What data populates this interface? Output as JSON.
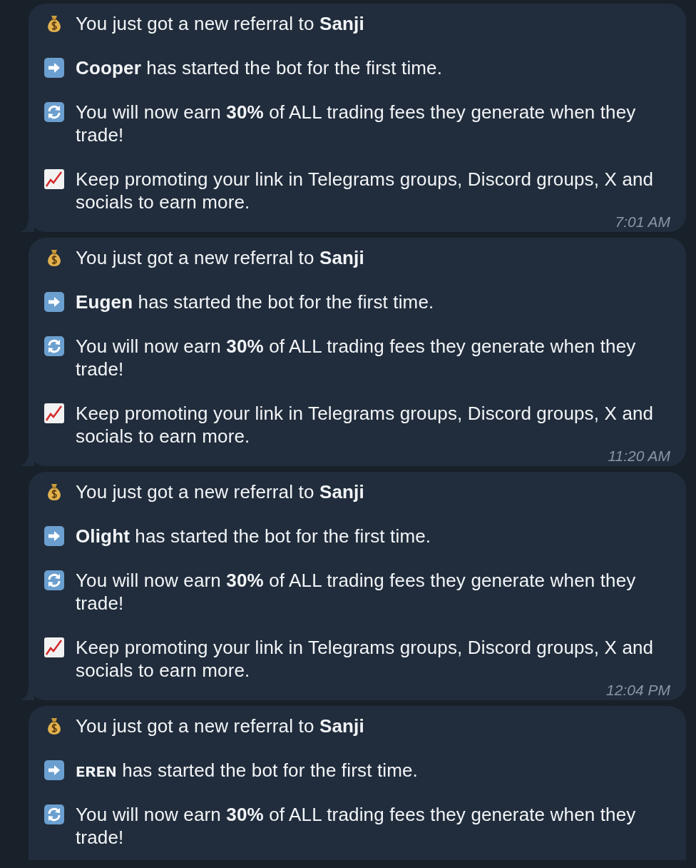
{
  "messages": [
    {
      "headline": "You just got a new referral to **Sanji**",
      "started": "**Cooper** has started the bot for the first time.",
      "earn": "You will now earn **30%** of ALL trading fees they generate when they trade!",
      "promote": "Keep promoting your link in Telegrams groups, Discord groups, X and socials to earn more.",
      "time": "7:01 AM"
    },
    {
      "headline": "You just got a new referral to **Sanji**",
      "started": "**Eugen** has started the bot for the first time.",
      "earn": "You will now earn **30%** of ALL trading fees they generate when they trade!",
      "promote": "Keep promoting your link in Telegrams groups, Discord groups, X and socials to earn more.",
      "time": "11:20 AM"
    },
    {
      "headline": "You just got a new referral to **Sanji**",
      "started": "**Olight** has started the bot for the first time.",
      "earn": "You will now earn **30%** of ALL trading fees they generate when they trade!",
      "promote": "Keep promoting your link in Telegrams groups, Discord groups, X and socials to earn more.",
      "time": "12:04 PM"
    },
    {
      "headline": "You just got a new referral to **Sanji**",
      "started": "**ᴇʀᴇɴ** has started the bot for the first time.",
      "earn": "You will now earn **30%** of ALL trading fees they generate when they trade!"
    }
  ]
}
